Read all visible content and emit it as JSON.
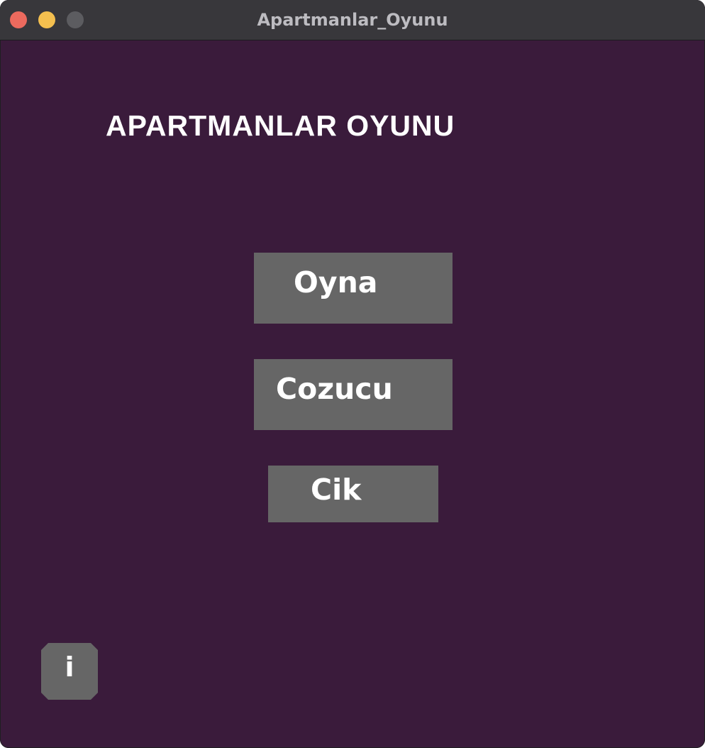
{
  "window": {
    "title": "Apartmanlar_Oyunu"
  },
  "game": {
    "title": "APARTMANLAR OYUNU"
  },
  "menu": {
    "play_label": "Oyna",
    "solver_label": "Cozucu",
    "exit_label": "Cik"
  },
  "info": {
    "label": "i"
  },
  "colors": {
    "background": "#3a1b3b",
    "button": "#666666",
    "text": "#ffffff",
    "titlebar": "#38373b"
  },
  "icons": [
    "close-button",
    "minimize-button",
    "zoom-button",
    "info-icon"
  ]
}
